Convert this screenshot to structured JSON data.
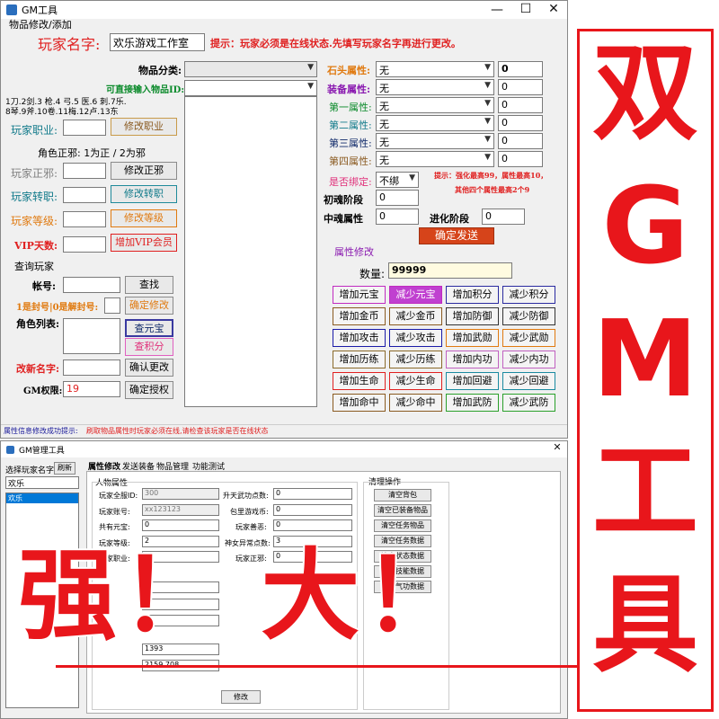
{
  "top_window": {
    "title": "GM工具",
    "section_title": "物品修改/添加",
    "player_name_label": "玩家名字:",
    "player_name_value": "欢乐游戏工作室",
    "notice": "提示：玩家必须是在线状态.先填写玩家名字再进行更改。",
    "item_category_label": "物品分类:",
    "direct_input_label": "可直接输入物品ID:",
    "weapon_types_line1": "1刀.2剑.3 枪.4 弓.5 医.6 刺.7乐.",
    "weapon_types_line2": "8琴.9斧.10卷.11梅.12卢.13东",
    "job_label": "玩家职业:",
    "job_button": "修改职业",
    "alignment_note": "角色正邪: 1为正 / 2为邪",
    "alignment_label": "玩家正邪:",
    "alignment_button": "修改正邪",
    "transfer_label": "玩家转职:",
    "transfer_button": "修改转职",
    "level_label": "玩家等级:",
    "level_button": "修改等级",
    "vip_label": "VIP天数:",
    "vip_button": "增加VIP会员",
    "query_title": "查询玩家",
    "account_label": "帐号:",
    "search_button": "查找",
    "ban_label": "1是封号|0是解封号:",
    "ban_button": "确定修改",
    "role_list_label": "角色列表:",
    "check_yuanbao_button": "查元宝",
    "check_points_button": "查积分",
    "rename_label": "改新名字:",
    "rename_button": "确认更改",
    "gm_label": "GM权限:",
    "gm_value": "19",
    "gm_button": "确定授权",
    "stone_label": "石头属性:",
    "equip_attr_label": "装备属性:",
    "attr1_label": "第一属性:",
    "attr2_label": "第二属性:",
    "attr3_label": "第三属性:",
    "attr4_label": "第四属性:",
    "none_option": "无",
    "zero": "0",
    "bind_label": "是否绑定:",
    "bind_value": "不绑",
    "bind_note_line1": "提示：强化最高99，属性最高10，",
    "bind_note_line2": "其他四个属性最高2个9",
    "soul_init_label": "初魂阶段",
    "soul_mid_label": "中魂属性",
    "evolve_label": "进化阶段",
    "send_button": "确定发送",
    "attr_modify_title": "属性修改",
    "qty_label": "数量:",
    "qty_value": "99999",
    "status_label": "属性信息修改成功提示:",
    "status_text": "刷取物品属性时玩家必须在线,请检查该玩家是否在线状态",
    "attr_buttons": [
      [
        "增加元宝",
        "减少元宝",
        "增加积分",
        "减少积分"
      ],
      [
        "增加金币",
        "减少金币",
        "增加防御",
        "减少防御"
      ],
      [
        "增加攻击",
        "减少攻击",
        "增加武勋",
        "减少武勋"
      ],
      [
        "增加历练",
        "减少历练",
        "增加内功",
        "减少内功"
      ],
      [
        "增加生命",
        "减少生命",
        "增加回避",
        "减少回避"
      ],
      [
        "增加命中",
        "减少命中",
        "增加武防",
        "减少武防"
      ]
    ]
  },
  "bottom_window": {
    "title": "GM管理工具",
    "select_player_label": "选择玩家名字",
    "refresh_button": "刷新",
    "player_input": "欢乐",
    "player_list_item": "欢乐",
    "tabs": [
      "属性修改",
      "发送装备",
      "物品管理",
      "功能测试"
    ],
    "group_label": "人物属性",
    "role_id_label": "玩家全服ID:",
    "role_id_value": "300",
    "account_label": "玩家账号:",
    "account_value": "xx123123",
    "yuanbao_label": "共有元宝:",
    "yuanbao_value": "0",
    "level_label": "玩家等级:",
    "level_value": "2",
    "job_label": "玩家职业:",
    "job_value": "1",
    "martial_pts_label": "升天武功点数:",
    "martial_pts_value": "0",
    "bag_label": "包里游戏币:",
    "bag_value": "0",
    "honor_label": "玩家善恶:",
    "honor_value": "0",
    "god_pts_label": "神女异常点数:",
    "god_pts_value": "3",
    "align_label": "玩家正邪:",
    "align_value": "0",
    "partial_value_a": "0",
    "partial_value_b": "1393",
    "partial_value_c": "2159.708",
    "modify_button": "修改",
    "clean_title": "清理操作",
    "clean_buttons": [
      "清空背包",
      "清空已装备物品",
      "清空任务物品",
      "清空任务数据",
      "清空状态数据",
      "清空技能数据",
      "清空气功数据"
    ]
  },
  "overlay": {
    "vertical_title": [
      "双",
      "G",
      "M",
      "工",
      "具"
    ],
    "slogan": "强！ 大！"
  },
  "colors": {
    "overlay_red": "#e8161b"
  }
}
